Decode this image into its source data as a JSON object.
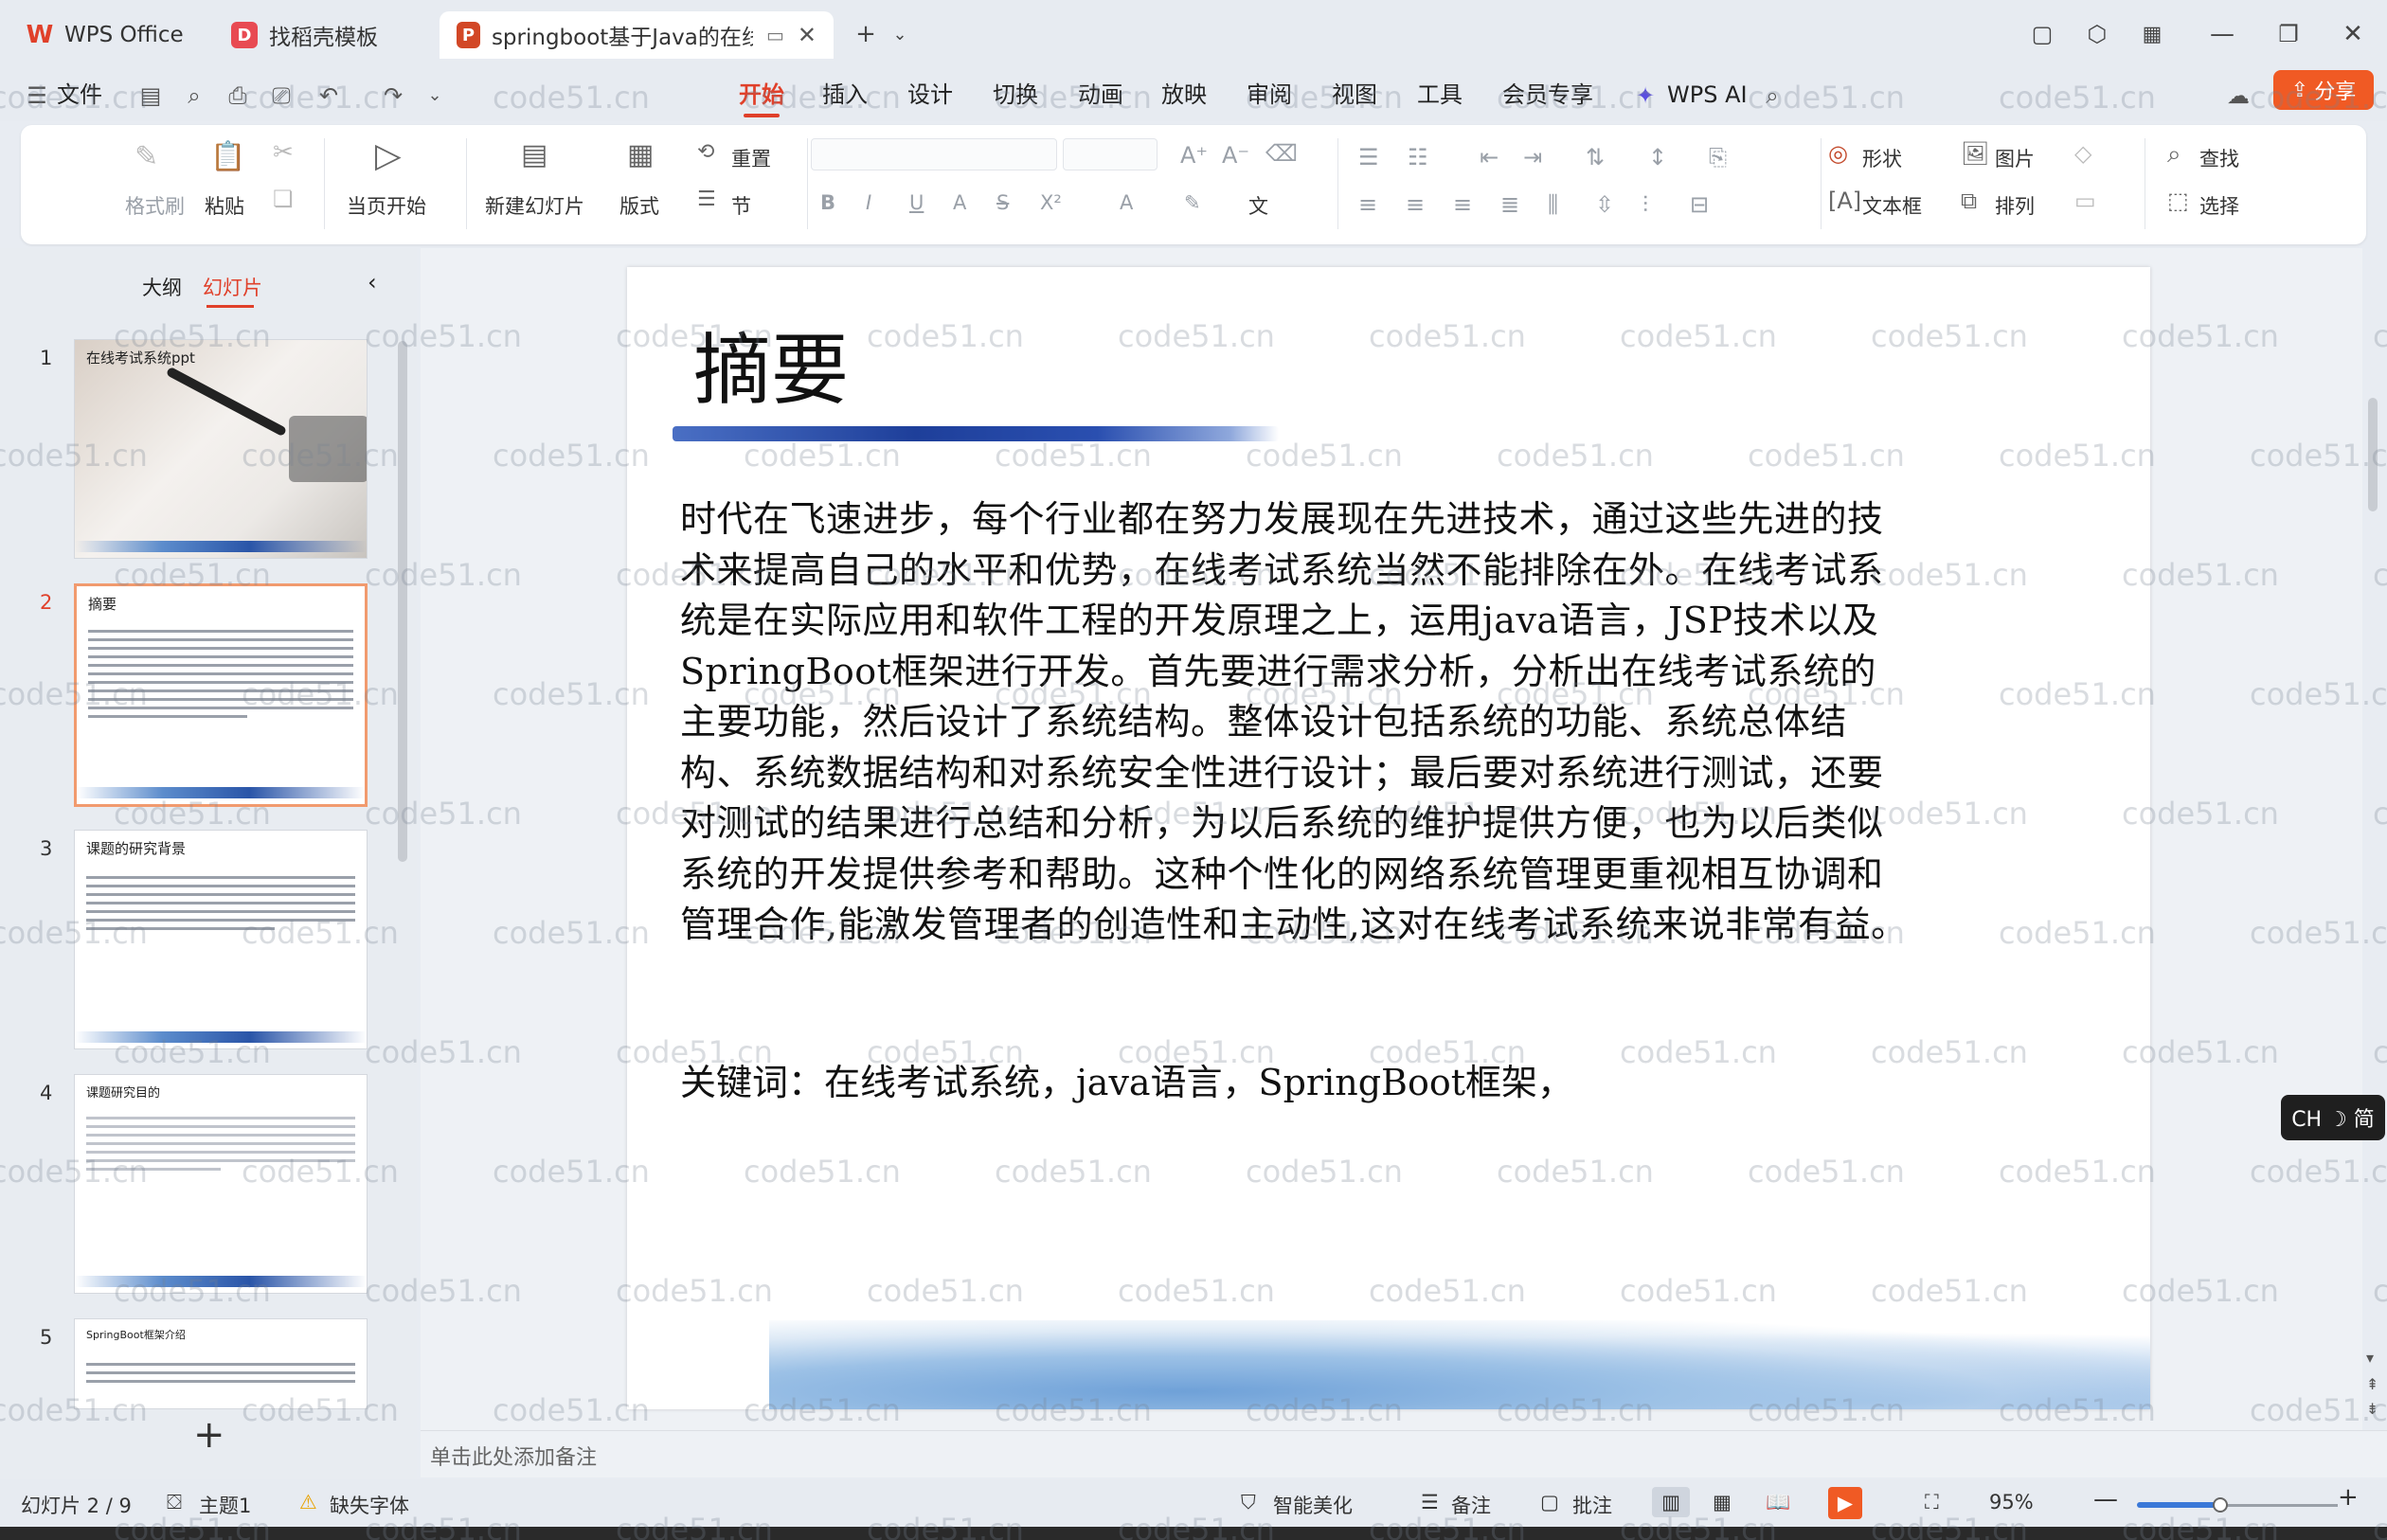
{
  "tabs": [
    {
      "label": "WPS Office",
      "icon": "wps-logo-icon",
      "color": "#e0402a"
    },
    {
      "label": "找稻壳模板",
      "icon": "docer-icon",
      "color": "#e84a52"
    },
    {
      "label": "springboot基于Java的在线考",
      "icon": "ppt-file-icon",
      "color": "#d24726"
    }
  ],
  "menubar": {
    "file": "文件",
    "items": [
      "开始",
      "插入",
      "设计",
      "切换",
      "动画",
      "放映",
      "审阅",
      "视图",
      "工具",
      "会员专享"
    ],
    "active": "开始",
    "wps_ai": "WPS AI",
    "share": "分享"
  },
  "ribbon": {
    "format_painter": "格式刷",
    "paste": "粘贴",
    "play_from_current": "当页开始",
    "new_slide": "新建幻灯片",
    "layout": "版式",
    "reset": "重置",
    "section": "节",
    "shape": "形状",
    "picture": "图片",
    "textbox": "文本框",
    "arrange": "排列",
    "find": "查找",
    "select": "选择"
  },
  "leftpanel": {
    "tab_outline": "大纲",
    "tab_slides": "幻灯片",
    "slides": [
      {
        "num": "1",
        "title": "在线考试系统ppt"
      },
      {
        "num": "2",
        "title": "摘要"
      },
      {
        "num": "3",
        "title": "课题的研究背景"
      },
      {
        "num": "4",
        "title": "课题研究目的"
      },
      {
        "num": "5",
        "title": "SpringBoot框架介绍"
      }
    ],
    "add": "+"
  },
  "slide": {
    "title": "摘要",
    "body": "时代在飞速进步，每个行业都在努力发展现在先进技术，通过这些先进的技术来提高自己的水平和优势，在线考试系统当然不能排除在外。在线考试系统是在实际应用和软件工程的开发原理之上，运用java语言，JSP技术以及SpringBoot框架进行开发。首先要进行需求分析，分析出在线考试系统的主要功能，然后设计了系统结构。整体设计包括系统的功能、系统总体结构、系统数据结构和对系统安全性进行设计；最后要对系统进行测试，还要对测试的结果进行总结和分析，为以后系统的维护提供方便，也为以后类似系统的开发提供参考和帮助。这种个性化的网络系统管理更重视相互协调和管理合作,能激发管理者的创造性和主动性,这对在线考试系统来说非常有益。",
    "keywords": "关键词：在线考试系统，java语言，SpringBoot框架，"
  },
  "notes_placeholder": "单击此处添加备注",
  "statusbar": {
    "slide_indicator": "幻灯片 2 / 9",
    "theme": "主题1",
    "missing_font": "缺失字体",
    "beautify": "智能美化",
    "notes": "备注",
    "comments": "批注",
    "zoom": "95%"
  },
  "ime_badge": "CH ☽ 简",
  "watermark": "code51.cn"
}
